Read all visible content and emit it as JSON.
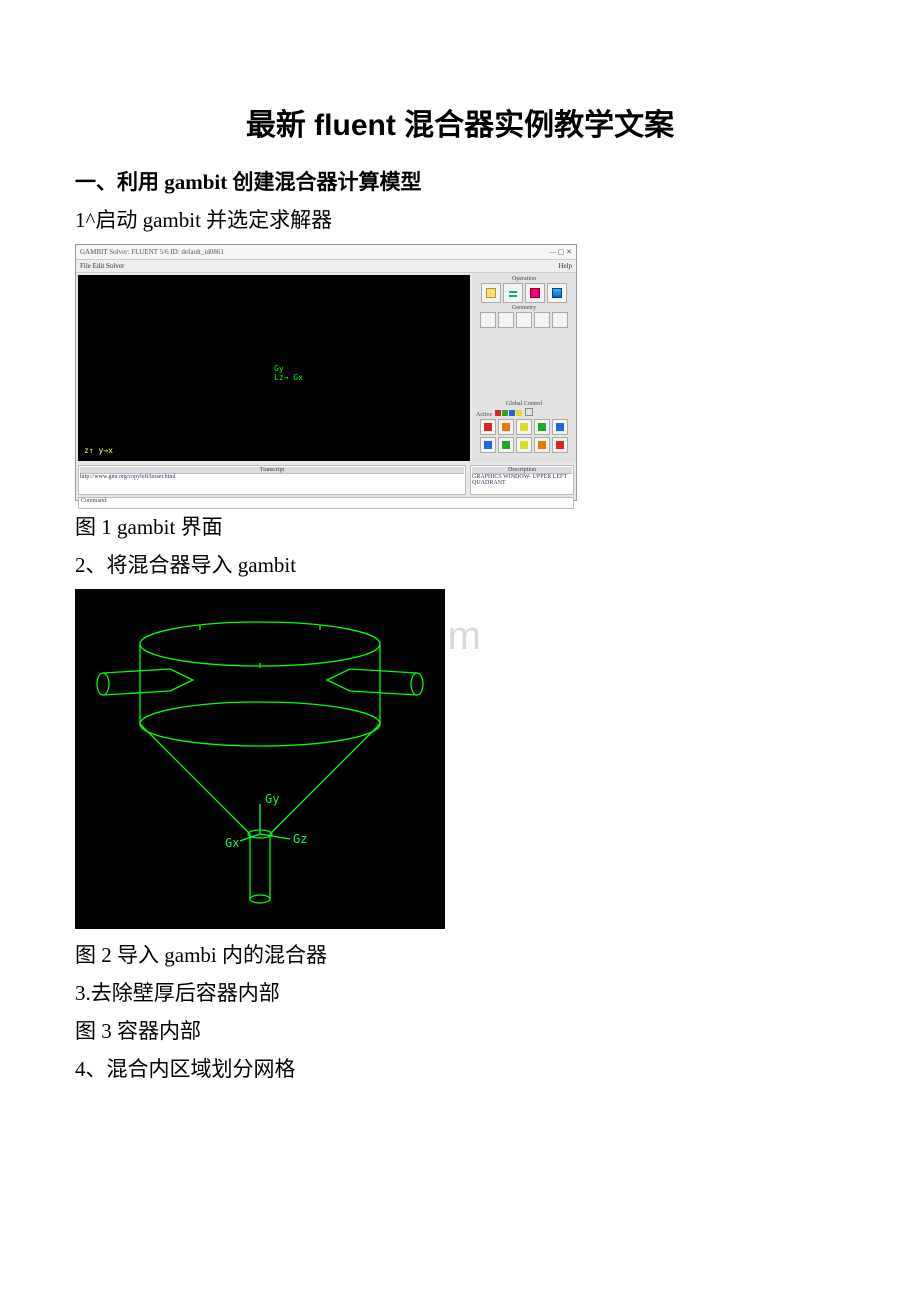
{
  "title": "最新 fluent 混合器实例教学文案",
  "section1": {
    "heading": "一、利用 gambit 创建混合器计算模型",
    "step1": "1^启动 gambit 并选定求解器",
    "caption1": "图 1 gambit 界面",
    "step2": "2、将混合器导入 gambit",
    "caption2": "图 2 导入 gambi 内的混合器",
    "step3": "3.去除壁厚后容器内部",
    "caption3": "图 3 容器内部",
    "step4": "4、混合内区域划分网格"
  },
  "fig1": {
    "window_title_left": "GAMBIT   Solver: FLUENT 5/6   ID: default_id0861",
    "menu_items": "File   Edit   Solver",
    "help": "Help",
    "axis_center_top": "Gy",
    "axis_center_bottom": "Lz→ Gx",
    "axis_corner": "z↑\n  y→x",
    "panel_operation": "Operation",
    "panel_geometry": "Geometry",
    "panel_global": "Global Control",
    "active_label": "Active",
    "transcript_label": "Transcript",
    "description_label": "Description",
    "transcript_text": "http://www.gnu.org/copyleft/lesser.html",
    "description_text": "GRAPHICS WINDOW- UPPER LEFT QUADRANT",
    "command_label": "Command:"
  },
  "fig2": {
    "label_gy": "Gy",
    "label_gx": "Gx",
    "label_gz": "Gz"
  },
  "watermark": "www.bdocx.com"
}
